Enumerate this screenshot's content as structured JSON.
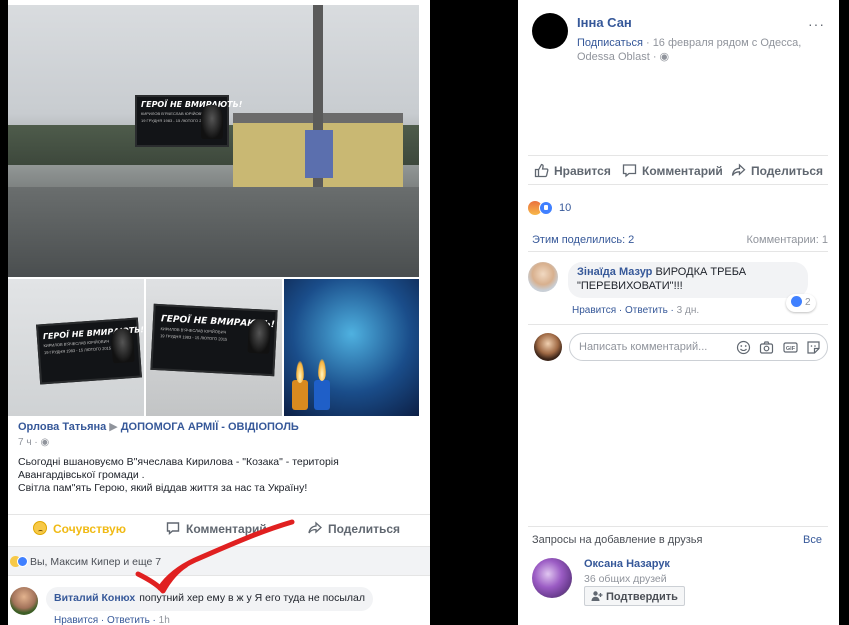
{
  "left_post": {
    "billboard_title": "ГЕРОЇ НЕ ВМИРАЮТЬ!",
    "billboard_name": "КИРИЛОВ В'ЯЧЕСЛАВ ЮРІЙОВИЧ",
    "billboard_dates": "19 ГРУДНЯ 1983 - 15 ЛЮТОГО 2015",
    "author": "Орлова Татьяна",
    "group": "ДОПОМОГА АРМІЇ - ОВІДІОПОЛЬ",
    "time": "7 ч",
    "text_line1": "Сьогодні вшановуємо В\"ячеслава Кирилова - \"Козака\" - територія Авангардівської громади .",
    "text_line2": "Світла пам\"ять Герою, який віддав життя за нас та Україну!",
    "actions": {
      "sympathy": "Сочувствую",
      "comment": "Комментарий",
      "share": "Поделиться"
    },
    "reactions_text": "Вы, Максим Кипер и еще 7",
    "comment": {
      "author": "Виталий Конюх",
      "text": "попутний хер ему в ж у Я его туда не посылал",
      "like": "Нравится",
      "reply": "Ответить",
      "time": "1h"
    }
  },
  "right_post": {
    "author": "Інна Сан",
    "more": "···",
    "follow": "Подписаться",
    "meta": "16 февраля рядом с Одесса, Odessa Oblast",
    "actions": {
      "like": "Нравится",
      "comment": "Комментарий",
      "share": "Поделиться"
    },
    "reaction_count": "10",
    "shared": "Этим поделились: 2",
    "comments_count": "Комментарии: 1",
    "comment": {
      "author": "Зінаїда Мазур",
      "text": "ВИРОДКА ТРЕБА \"ПЕРЕВИХОВАТИ\"!!!",
      "likes": "2",
      "like": "Нравится",
      "reply": "Ответить",
      "time": "3 дн."
    },
    "write_placeholder": "Написать комментарий..."
  },
  "friend_requests": {
    "title": "Запросы на добавление в друзья",
    "see_all": "Все",
    "person": {
      "name": "Оксана Назарук",
      "mutual": "36 общих друзей",
      "confirm": "Подтвердить"
    }
  },
  "colors": {
    "link": "#365899",
    "muted": "#90949c",
    "annotation_arrow": "#e02020"
  }
}
